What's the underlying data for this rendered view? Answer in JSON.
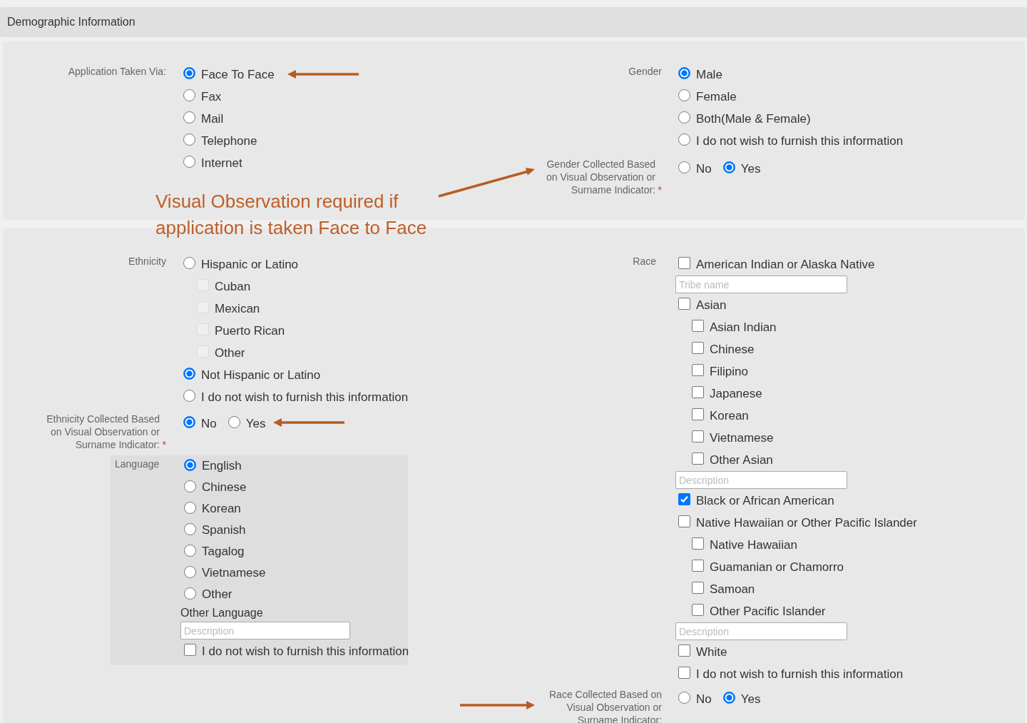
{
  "header": {
    "title": "Demographic Information"
  },
  "application_taken_via": {
    "label": "Application Taken Via:",
    "options": [
      {
        "label": "Face To Face",
        "selected": true
      },
      {
        "label": "Fax",
        "selected": false
      },
      {
        "label": "Mail",
        "selected": false
      },
      {
        "label": "Telephone",
        "selected": false
      },
      {
        "label": "Internet",
        "selected": false
      }
    ]
  },
  "gender": {
    "label": "Gender",
    "options": [
      {
        "label": "Male",
        "selected": true
      },
      {
        "label": "Female",
        "selected": false
      },
      {
        "label": "Both(Male & Female)",
        "selected": false
      },
      {
        "label": "I do not wish to furnish this information",
        "selected": false
      }
    ]
  },
  "gender_visual_observation": {
    "label": "Gender Collected Based on Visual Observation or Surname Indicator:",
    "required_mark": "*",
    "options": [
      {
        "label": "No",
        "selected": false
      },
      {
        "label": "Yes",
        "selected": true
      }
    ]
  },
  "ethnicity": {
    "label": "Ethnicity",
    "options": [
      {
        "label": "Hispanic or Latino",
        "selected": false,
        "children": [
          {
            "label": "Cuban",
            "checked": false,
            "disabled": true
          },
          {
            "label": "Mexican",
            "checked": false,
            "disabled": true
          },
          {
            "label": "Puerto Rican",
            "checked": false,
            "disabled": true
          },
          {
            "label": "Other",
            "checked": false,
            "disabled": true
          }
        ]
      },
      {
        "label": "Not Hispanic or Latino",
        "selected": true
      },
      {
        "label": "I do not wish to furnish this information",
        "selected": false
      }
    ]
  },
  "ethnicity_visual_observation": {
    "label": "Ethnicity Collected Based on Visual Observation or Surname Indicator:",
    "required_mark": "*",
    "options": [
      {
        "label": "No",
        "selected": true
      },
      {
        "label": "Yes",
        "selected": false
      }
    ]
  },
  "language": {
    "label": "Language",
    "options": [
      {
        "label": "English",
        "selected": true
      },
      {
        "label": "Chinese",
        "selected": false
      },
      {
        "label": "Korean",
        "selected": false
      },
      {
        "label": "Spanish",
        "selected": false
      },
      {
        "label": "Tagalog",
        "selected": false
      },
      {
        "label": "Vietnamese",
        "selected": false
      },
      {
        "label": "Other",
        "selected": false
      }
    ],
    "other_label": "Other Language",
    "other_field": {
      "placeholder": "Description"
    },
    "decline": {
      "label": "I do not wish to furnish this information",
      "checked": false
    }
  },
  "race": {
    "label": "Race",
    "items": [
      {
        "kind": "checkbox",
        "label": "American Indian or Alaska Native",
        "checked": false
      },
      {
        "kind": "field",
        "placeholder": "Tribe name"
      },
      {
        "kind": "checkbox",
        "label": "Asian",
        "checked": false,
        "children": [
          {
            "label": "Asian Indian",
            "checked": false
          },
          {
            "label": "Chinese",
            "checked": false
          },
          {
            "label": "Filipino",
            "checked": false
          },
          {
            "label": "Japanese",
            "checked": false
          },
          {
            "label": "Korean",
            "checked": false
          },
          {
            "label": "Vietnamese",
            "checked": false
          },
          {
            "label": "Other Asian",
            "checked": false
          }
        ]
      },
      {
        "kind": "field",
        "placeholder": "Description"
      },
      {
        "kind": "checkbox",
        "label": "Black or African American",
        "checked": true
      },
      {
        "kind": "checkbox",
        "label": "Native Hawaiian or Other Pacific Islander",
        "checked": false,
        "children": [
          {
            "label": "Native Hawaiian",
            "checked": false
          },
          {
            "label": "Guamanian or Chamorro",
            "checked": false
          },
          {
            "label": "Samoan",
            "checked": false
          },
          {
            "label": "Other Pacific Islander",
            "checked": false
          }
        ]
      },
      {
        "kind": "field",
        "placeholder": "Description"
      },
      {
        "kind": "checkbox",
        "label": "White",
        "checked": false
      },
      {
        "kind": "checkbox",
        "label": "I do not wish to furnish this information",
        "checked": false
      }
    ]
  },
  "race_visual_observation": {
    "label": "Race Collected Based on Visual Observation or Surname Indicator:",
    "options": [
      {
        "label": "No",
        "selected": false
      },
      {
        "label": "Yes",
        "selected": true
      }
    ]
  },
  "annotation": {
    "text": "Visual Observation required if application is taken Face to Face"
  }
}
